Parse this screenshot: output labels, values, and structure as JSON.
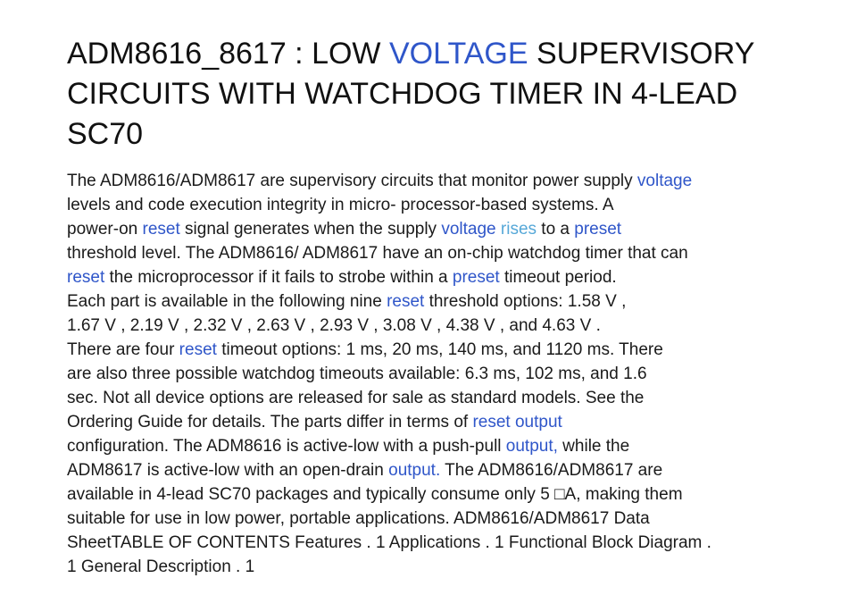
{
  "document": {
    "title": {
      "line1": {
        "a": "ADM8616_8617 : LOW ",
        "kw": "VOLTAGE",
        "b": " SUPERVISORY"
      },
      "line2": "CIRCUITS WITH WATCHDOG TIMER IN 4-LEAD",
      "line3": "SC70"
    },
    "body": {
      "l1": {
        "a": "The ADM8616/ADM8617 are supervisory circuits that monitor power supply ",
        "kw": "voltage"
      },
      "l2": "levels and code execution integrity in micro- processor-based systems. A",
      "l3": {
        "a": "power-on ",
        "kw1": "reset",
        "b": " signal generates when the supply ",
        "kw2": "voltage",
        "sp": " ",
        "kw3": "rises",
        "c": " to a ",
        "kw4": "preset"
      },
      "l4": "threshold level. The ADM8616/ ADM8617 have an on-chip watchdog timer that can",
      "l5": {
        "kw1": "reset",
        "a": " the microprocessor if it fails to strobe within a ",
        "kw2": "preset",
        "b": " timeout period."
      },
      "l6": {
        "a": "Each part is available in the following nine ",
        "kw": "reset",
        "b": " threshold options: 1.58 V ,"
      },
      "l7": "1.67 V , 2.19 V , 2.32 V , 2.63 V , 2.93 V , 3.08 V , 4.38 V , and 4.63 V .",
      "l8": {
        "a": "There are four ",
        "kw": "reset",
        "b": " timeout options: 1 ms, 20 ms, 140 ms, and 1120 ms. There"
      },
      "l9": "are also three possible watchdog timeouts available: 6.3 ms, 102 ms, and 1.6",
      "l10": "sec. Not all device options are released for sale as standard models. See the",
      "l11": {
        "a": "Ordering Guide for details. The parts differ in terms of ",
        "kw": "reset output"
      },
      "l12": {
        "a": "configuration. The ADM8616 is active-low with a push-pull ",
        "kw": "output,",
        "b": " while the"
      },
      "l13": {
        "a": "ADM8617 is active-low with an open-drain ",
        "kw": "output.",
        "b": " The ADM8616/ADM8617 are"
      },
      "l14": "available in 4-lead SC70 packages and typically consume only 5 □A,    making them",
      "l15": "suitable for use in low power, portable applications. ADM8616/ADM8617 Data",
      "l16": "SheetTABLE OF CONTENTS Features . 1 Applications . 1 Functional Block Diagram .",
      "l17": "1 General Description . 1"
    }
  },
  "colors": {
    "keyword": "#2f56c9",
    "keyword_light": "#56a8d8",
    "text": "#1a1a1a"
  }
}
